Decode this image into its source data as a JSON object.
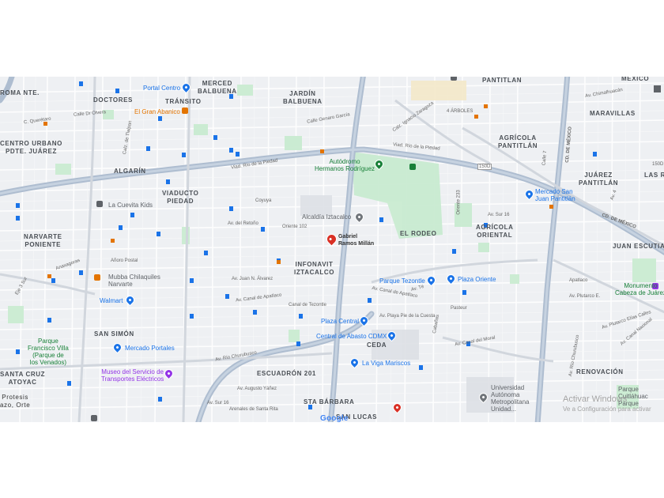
{
  "map": {
    "areas": [
      {
        "id": "roma-nte",
        "text": "ROMA NTE."
      },
      {
        "id": "doctores",
        "text": "DOCTORES"
      },
      {
        "id": "merced-balbuena",
        "text": "MERCED\nBALBUENA"
      },
      {
        "id": "transito",
        "text": "TRÁNSITO"
      },
      {
        "id": "jardin-balbuena",
        "text": "JARDÍN\nBALBUENA"
      },
      {
        "id": "pantitlan",
        "text": "PANTITLAN"
      },
      {
        "id": "mexico",
        "text": "MÉXICO"
      },
      {
        "id": "maravillas",
        "text": "MARAVILLAS"
      },
      {
        "id": "centro-urbano",
        "text": "CENTRO URBANO\nPDTE. JUÁREZ"
      },
      {
        "id": "algarin",
        "text": "ALGARÍN"
      },
      {
        "id": "agricola-pantitlan",
        "text": "AGRÍCOLA\nPANTITLÁN"
      },
      {
        "id": "juarez-pantitlan",
        "text": "JUÁREZ\nPANTITLÁN"
      },
      {
        "id": "las-r",
        "text": "LAS R"
      },
      {
        "id": "viaducto-piedad",
        "text": "VIADUCTO\nPIEDAD"
      },
      {
        "id": "el-rodeo",
        "text": "EL RODEO"
      },
      {
        "id": "agricola-oriental",
        "text": "AGRÍCOLA\nORIENTAL"
      },
      {
        "id": "narvarte-poniente",
        "text": "NARVARTE\nPONIENTE"
      },
      {
        "id": "juan-escutia",
        "text": "JUAN ESCUTIA"
      },
      {
        "id": "infonavit",
        "text": "INFONAVIT\nIZTACALCO"
      },
      {
        "id": "san-simon",
        "text": "SAN SIMÓN"
      },
      {
        "id": "ceda",
        "text": "CEDA"
      },
      {
        "id": "santa-cruz",
        "text": "SANTA CRUZ\nATOYAC"
      },
      {
        "id": "escuadron",
        "text": "ESCUADRÓN 201"
      },
      {
        "id": "renovacion",
        "text": "RENOVACIÓN"
      },
      {
        "id": "sta-barbara",
        "text": "STA BÁRBARA"
      },
      {
        "id": "san-lucas",
        "text": "SAN LUCAS"
      },
      {
        "id": "protesis",
        "text": "Protesis\nazo, Orte"
      },
      {
        "id": "cuatro-arboles",
        "text": "4 ÁRBOLES"
      }
    ],
    "pois": [
      {
        "id": "portal-centro",
        "text": "Portal Centro",
        "color": "#1a73e8"
      },
      {
        "id": "gran-abanico",
        "text": "El Gran Abanico",
        "color": "#e37400"
      },
      {
        "id": "autodromo",
        "text": "Autódromo\nHermanos Rodríguez",
        "color": "#188038"
      },
      {
        "id": "cuevita",
        "text": "La Cuevita Kids",
        "color": "#5f6368"
      },
      {
        "id": "alcaldia",
        "text": "Alcaldía Iztacalco",
        "color": "#5f6368"
      },
      {
        "id": "gabriel",
        "text": "Gabriel\nRamos Millán",
        "color": "#d93025"
      },
      {
        "id": "mercado-san-juan",
        "text": "Mercado San\nJuan Pantitlán",
        "color": "#1a73e8"
      },
      {
        "id": "mubba",
        "text": "Mubba Chilaquiles\nNarvarte",
        "color": "#e37400"
      },
      {
        "id": "walmart",
        "text": "Walmart",
        "color": "#1a73e8"
      },
      {
        "id": "parque-tezontle",
        "text": "Parque Tezontle",
        "color": "#1a73e8"
      },
      {
        "id": "plaza-oriente",
        "text": "Plaza Oriente",
        "color": "#1a73e8"
      },
      {
        "id": "monumento",
        "text": "Monumento\nCabeza de Juárez",
        "color": "#188038"
      },
      {
        "id": "plaza-central",
        "text": "Plaza Central",
        "color": "#1a73e8"
      },
      {
        "id": "central-abasto",
        "text": "Central de Abasto CDMX",
        "color": "#1a73e8"
      },
      {
        "id": "parque-fv",
        "text": "Parque\nFrancisco Villa\n(Parque de\nlos Venados)",
        "color": "#188038"
      },
      {
        "id": "mercado-portales",
        "text": "Mercado Portales",
        "color": "#1a73e8"
      },
      {
        "id": "museo",
        "text": "Museo del Servicio de\nTransportes Eléctricos",
        "color": "#9334e6"
      },
      {
        "id": "viga",
        "text": "La Viga Mariscos",
        "color": "#1a73e8"
      },
      {
        "id": "uam",
        "text": "Universidad\nAutónoma\nMetropolitana\nUnidad...",
        "color": "#5f6368"
      },
      {
        "id": "parque-cuitlahuac",
        "text": "Parque\nCuitláhuac\nParque",
        "color": "#5f6368"
      }
    ],
    "streets": [
      {
        "id": "s1",
        "text": "C. Querétaro"
      },
      {
        "id": "s2",
        "text": "Calle Dr Olvera"
      },
      {
        "id": "s3",
        "text": "Viad. Río de la Piedad"
      },
      {
        "id": "s4",
        "text": "Coyuya"
      },
      {
        "id": "s5",
        "text": "Av. del Retoño"
      },
      {
        "id": "s6",
        "text": "Oriente 102"
      },
      {
        "id": "s7",
        "text": "Av. Juan N. Álvarez"
      },
      {
        "id": "s8",
        "text": "Av. Canal de Apatlaco"
      },
      {
        "id": "s9",
        "text": "Canal de Tezontle"
      },
      {
        "id": "s10",
        "text": "Av. Río Churubusco"
      },
      {
        "id": "s11",
        "text": "Av. Sur 16"
      },
      {
        "id": "s12",
        "text": "Av. Augusto Yáñez"
      },
      {
        "id": "s13",
        "text": "Av. Plutarco Elías Calles"
      },
      {
        "id": "s14",
        "text": "Av. Canal del Moral"
      },
      {
        "id": "s15",
        "text": "Apatlaco"
      },
      {
        "id": "s16",
        "text": "Añoro Postal"
      },
      {
        "id": "s17",
        "text": "Anaxagoras"
      },
      {
        "id": "s18",
        "text": "Calz. de Tlalpan"
      },
      {
        "id": "s19",
        "text": "Eje 3 Sur"
      },
      {
        "id": "s20",
        "text": "Viad. Río de la Piedad"
      },
      {
        "id": "s21",
        "text": "CD. DE MÉXICO"
      },
      {
        "id": "s22",
        "text": "CD. DE MÉXICO"
      },
      {
        "id": "s23",
        "text": "Av. Chimalhuacán"
      },
      {
        "id": "s24",
        "text": "Calle Genaro García"
      },
      {
        "id": "s25",
        "text": "Calz. Ignacio Zaragoza"
      },
      {
        "id": "s26",
        "text": "Oriente 233"
      },
      {
        "id": "s27",
        "text": "Av. Sur 16"
      },
      {
        "id": "s28",
        "text": "Av. Río Churubusco"
      },
      {
        "id": "s29",
        "text": "Av. Playa Pie de la Cuesta"
      },
      {
        "id": "s30",
        "text": "Av. Té"
      },
      {
        "id": "s31",
        "text": "Cabañas"
      },
      {
        "id": "s32",
        "text": "Av. Canal de Apatlaco"
      },
      {
        "id": "s33",
        "text": "Arenales de Santa Rita"
      },
      {
        "id": "s34",
        "text": "Pasteur"
      },
      {
        "id": "s35",
        "text": "Av. Canal Nacional"
      },
      {
        "id": "s36",
        "text": "150D"
      },
      {
        "id": "s37",
        "text": "150D"
      },
      {
        "id": "s38",
        "text": "Calle 7"
      },
      {
        "id": "s39",
        "text": "Av. 4"
      },
      {
        "id": "s40",
        "text": "Av. Plutarco E."
      }
    ],
    "google": "Google",
    "watermark": {
      "line1": "Activar Windows",
      "line2": "Ve a Configuración para activar"
    }
  }
}
